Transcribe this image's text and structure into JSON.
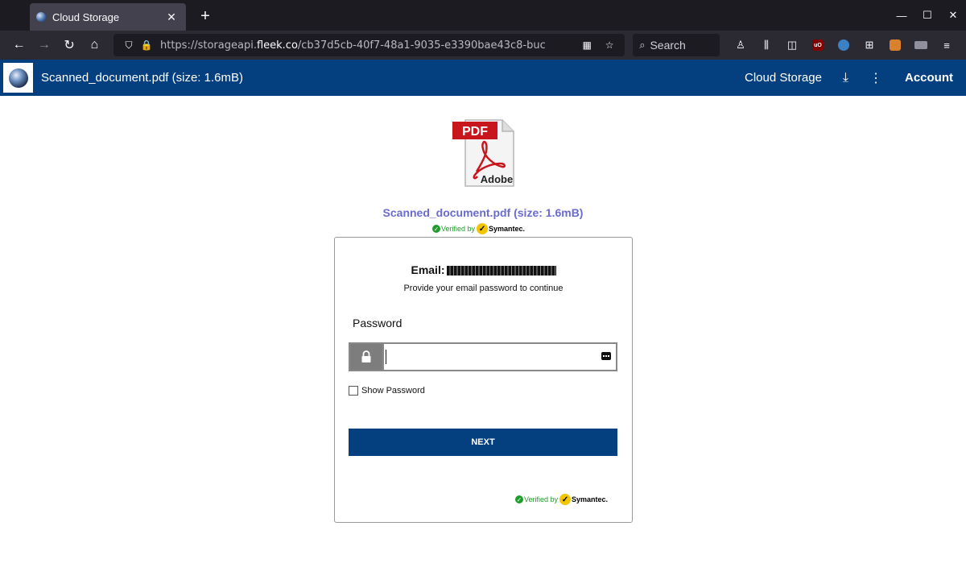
{
  "browser": {
    "tab_title": "Cloud Storage",
    "url_prefix": "https://storageapi.",
    "url_domain": "fleek.co",
    "url_rest": "/cb37d5cb-40f7-48a1-9035-e3390bae43c8-buc",
    "search_placeholder": "Search"
  },
  "app": {
    "title": "Scanned_document.pdf (size: 1.6mB)",
    "nav_link": "Cloud Storage",
    "account_label": "Account"
  },
  "file": {
    "name": "Scanned_document.pdf (size: 1.6mB)",
    "pdf_badge": "PDF",
    "pdf_brand": "Adobe"
  },
  "verified": {
    "prefix": "Verified by",
    "brand": "Symantec."
  },
  "form": {
    "email_label": "Email:",
    "instruction": "Provide your email password to continue",
    "password_label": "Password",
    "password_value": "",
    "show_password_label": "Show Password",
    "submit_label": "NEXT"
  }
}
